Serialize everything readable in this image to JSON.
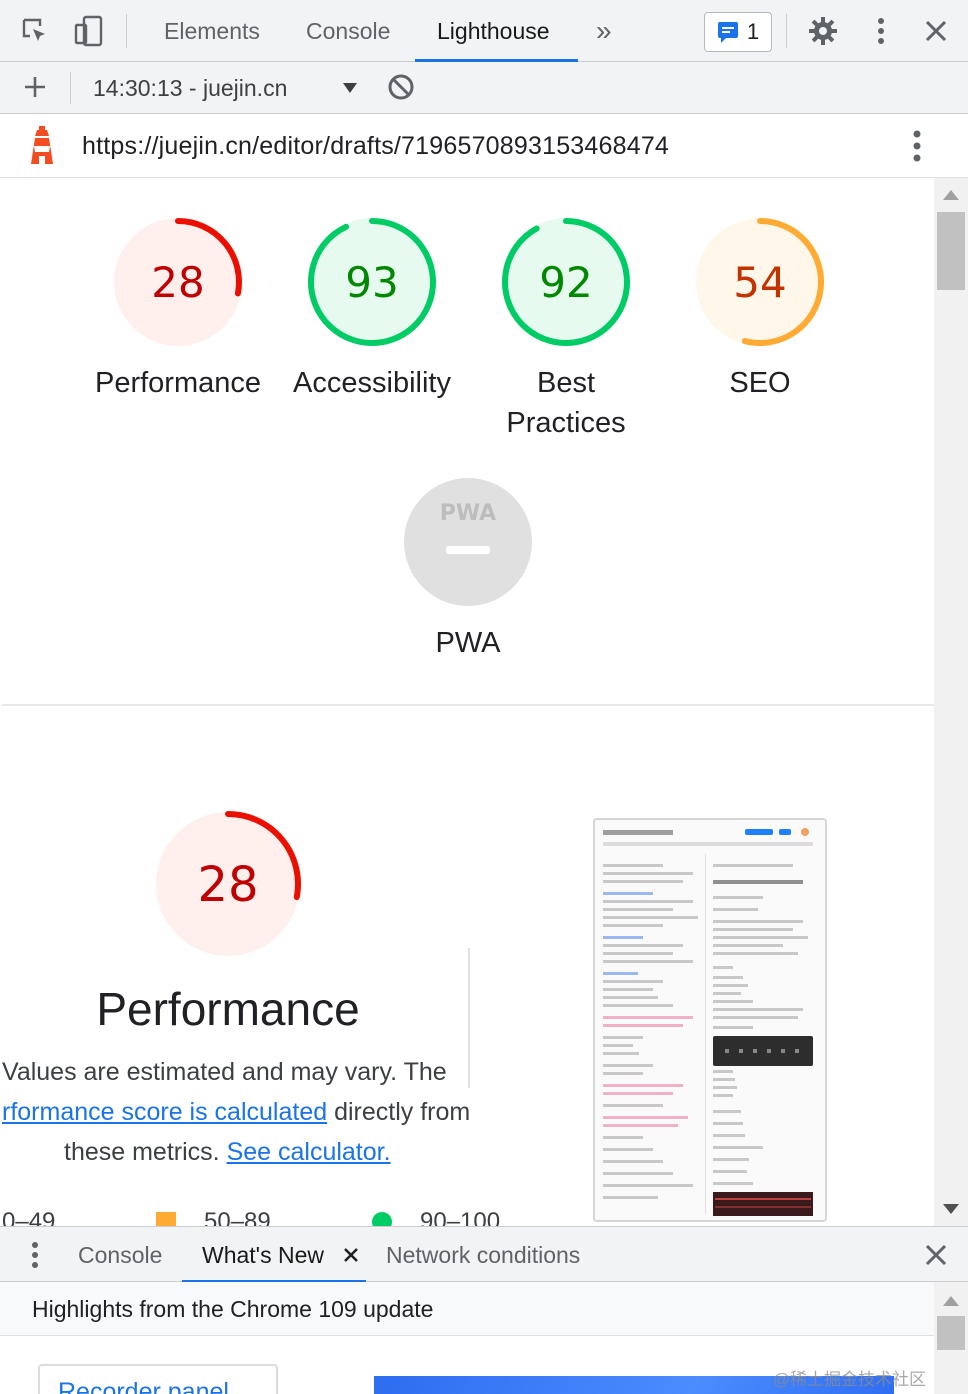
{
  "devtools": {
    "tabs": [
      {
        "label": "Elements"
      },
      {
        "label": "Console"
      },
      {
        "label": "Lighthouse"
      }
    ],
    "more_tabs_label": "»",
    "issues_count": "1"
  },
  "toolbar": {
    "report_selector": "14:30:13 - juejin.cn"
  },
  "url_bar": {
    "url": "https://juejin.cn/editor/drafts/7196570893153468474"
  },
  "scores": [
    {
      "name": "Performance",
      "score": 28,
      "color": "#eb0f00",
      "bg": "#fff0ee"
    },
    {
      "name": "Accessibility",
      "score": 93,
      "color": "#00cc66",
      "bg": "#e6faf0"
    },
    {
      "name": "Best\nPractices",
      "score": 92,
      "color": "#00cc66",
      "bg": "#e6faf0"
    },
    {
      "name": "SEO",
      "score": 54,
      "color": "#ffaa33",
      "bg": "#fff7ea"
    }
  ],
  "pwa": {
    "badge_text": "PWA",
    "label": "PWA"
  },
  "performance_section": {
    "score": 28,
    "title": "Performance",
    "desc_line1": "Values are estimated and may vary. The",
    "desc_link": "rformance score is calculated",
    "desc_line2_rest": " directly from",
    "desc_line3_prefix": "these metrics. ",
    "desc_calc_link": "See calculator.",
    "legend": [
      {
        "range": "0–49",
        "color": "#eb0f00"
      },
      {
        "range": "50–89",
        "color": "#ffaa33"
      },
      {
        "range": "90–100",
        "color": "#00cc66"
      }
    ]
  },
  "drawer": {
    "tabs": [
      {
        "label": "Console"
      },
      {
        "label": "What's New"
      },
      {
        "label": "Network conditions"
      }
    ],
    "highlights_title": "Highlights from the Chrome 109 update",
    "card_link": "Recorder panel"
  },
  "watermark": "@稀土掘金技术社区"
}
